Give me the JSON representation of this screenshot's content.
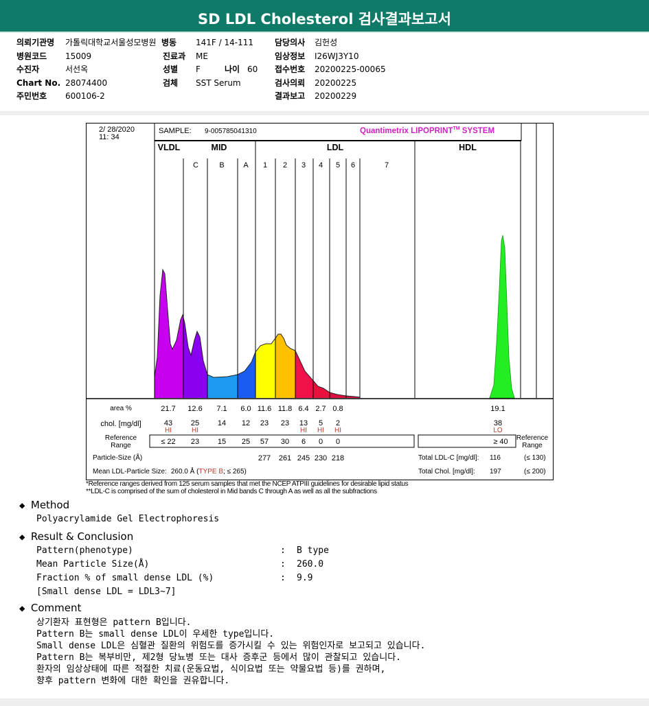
{
  "title": "SD LDL Cholesterol 검사결과보고서",
  "info": {
    "col1": [
      {
        "k": "의뢰기관명",
        "v": "가톨릭대학교서울성모병원"
      },
      {
        "k": "병원코드",
        "v": "15009"
      },
      {
        "k": "수진자",
        "v": "서선옥"
      },
      {
        "k": "Chart No.",
        "v": "28074400"
      },
      {
        "k": "주민번호",
        "v": "600106-2"
      }
    ],
    "col2": [
      {
        "k": "병동",
        "v": "141F / 14-111"
      },
      {
        "k": "진료과",
        "v": "ME"
      },
      {
        "k": "성별",
        "v": "F"
      },
      {
        "k": "검체",
        "v": "SST Serum"
      }
    ],
    "age": {
      "k": "나이",
      "v": "60"
    },
    "col3": [
      {
        "k": "담당의사",
        "v": "김헌성"
      },
      {
        "k": "임상정보",
        "v": "I26WJ3Y10"
      },
      {
        "k": "접수번호",
        "v": "20200225-00065"
      },
      {
        "k": "검사의뢰",
        "v": "20200225"
      },
      {
        "k": "결과보고",
        "v": "20200229"
      }
    ]
  },
  "chart_data": {
    "type": "area",
    "date": "2/ 28/2020",
    "time": "11: 34",
    "sample_label": "SAMPLE:",
    "sample": "9-005785041310",
    "brand": "Quantimetrix LIPOPRINT",
    "brand_tm": "TM",
    "brand_suffix": " SYSTEM",
    "groups": [
      "VLDL",
      "MID",
      "LDL",
      "HDL"
    ],
    "bands": [
      "C",
      "B",
      "A",
      "1",
      "2",
      "3",
      "4",
      "5",
      "6",
      "7"
    ],
    "row_labels": {
      "area": "area %",
      "chol": "chol. [mg/dl]",
      "ref": "Reference Range",
      "size": "Particle-Size (Å)"
    },
    "area": [
      "21.7",
      "12.6",
      "7.1",
      "6.0",
      "11.6",
      "11.8",
      "6.4",
      "2.7",
      "0.8"
    ],
    "chol": [
      "43",
      "25",
      "14",
      "12",
      "23",
      "23",
      "13",
      "5",
      "2"
    ],
    "flags": [
      "HI",
      "HI",
      "",
      "",
      "",
      "",
      "HI",
      "HI",
      "HI"
    ],
    "ref": [
      "≤ 22",
      "23",
      "15",
      "25",
      "57",
      "30",
      "6",
      "0",
      "0"
    ],
    "sizes": [
      "277",
      "261",
      "245",
      "230",
      "218"
    ],
    "hdl": {
      "area": "19.1",
      "chol": "38",
      "flag": "LO",
      "ref": "≥ 40"
    },
    "ref_right": "Reference Range",
    "mean_label": "Mean LDL-Particle Size:",
    "mean_value": "260.0 Å (",
    "mean_type": "TYPE B",
    "mean_ref": "; ≤ 265)",
    "total_ldl_label": "Total LDL-C [mg/dl]:",
    "total_ldl": "116",
    "total_ldl_ref": "(≤ 130)",
    "total_chol_label": "Total Chol. [mg/dl]:",
    "total_chol": "197",
    "total_chol_ref": "(≤ 200)",
    "colors": [
      "#c800f0",
      "#8a00f0",
      "#1e9bf0",
      "#1a5cf0",
      "#ffff00",
      "#ffc000",
      "#f0104a",
      "#e8103c",
      "#dc1040",
      "#d81048"
    ],
    "hdl_color": "#22ee22"
  },
  "footnotes": [
    "*Reference ranges derived from 125 serum samples that met the NCEP ATPIII guidelines for desirable lipid status",
    "**LDL-C is comprised of the sum of cholesterol in Mid bands C through A as well as all the subfractions"
  ],
  "method": {
    "title": "Method",
    "text": "Polyacrylamide Gel Electrophoresis"
  },
  "result": {
    "title": "Result & Conclusion",
    "rows": [
      {
        "k": "Pattern(phenotype)",
        "v": "B type"
      },
      {
        "k": "Mean Particle Size(Å)",
        "v": "260.0"
      },
      {
        "k": "Fraction % of small dense LDL (%)",
        "v": "9.9"
      }
    ],
    "note": "[Small dense LDL = LDL3~7]"
  },
  "comment": {
    "title": "Comment",
    "lines": [
      "상기환자 표현형은 pattern B입니다.",
      "Pattern B는 small dense LDL이 우세한 type입니다.",
      "Small dense LDL은 심혈관 질환의 위험도를 증가시킬 수 있는 위험인자로 보고되고 있습니다.",
      "Pattern B는 복부비만, 제2형 당뇨병 또는 대사 증후군 등에서 많이 관찰되고 있습니다.",
      "환자의 임상상태에 따른 적절한 치료(운동요법, 식이요법 또는 약물요법 등)를 권하며,",
      "향후 pattern 변화에 대한 확인을 권유합니다."
    ]
  }
}
